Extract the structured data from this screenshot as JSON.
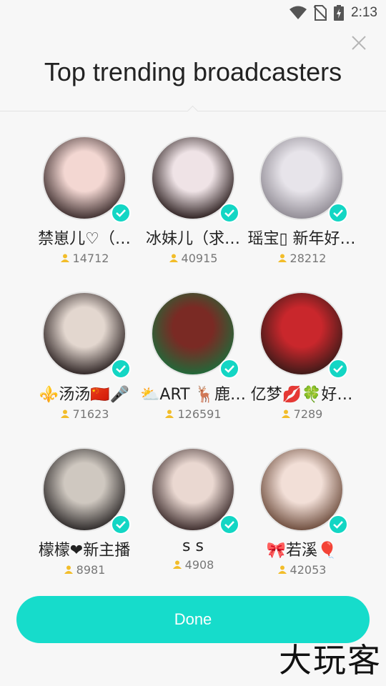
{
  "status": {
    "time": "2:13"
  },
  "header": {
    "title": "Top trending broadcasters"
  },
  "broadcasters": [
    {
      "name": "禁崽儿♡（…",
      "viewers": "14712",
      "tone": [
        "#f3d7d2",
        "#3a2b2b"
      ]
    },
    {
      "name": "冰妹儿（求…",
      "viewers": "40915",
      "tone": [
        "#efe3e6",
        "#2a1d1d"
      ]
    },
    {
      "name": "瑶宝▯ 新年好…",
      "viewers": "28212",
      "tone": [
        "#e7e4ea",
        "#8f8a93"
      ]
    },
    {
      "name": "⚜️汤汤🇨🇳🎤",
      "viewers": "71623",
      "tone": [
        "#e3d7cf",
        "#2a2020"
      ]
    },
    {
      "name": "⛅ART 🦌鹿…",
      "viewers": "126591",
      "tone": [
        "#7a2a24",
        "#1e6b3a"
      ]
    },
    {
      "name": "亿梦💋🍀好…",
      "viewers": "7289",
      "tone": [
        "#c9272c",
        "#3a1a18"
      ]
    },
    {
      "name": "檬檬❤新主播",
      "viewers": "8981",
      "tone": [
        "#cfc8c0",
        "#2a2626"
      ]
    },
    {
      "name": "s s",
      "viewers": "4908",
      "tone": [
        "#ead8d1",
        "#3a2a2a"
      ]
    },
    {
      "name": "🎀若溪🎈",
      "viewers": "42053",
      "tone": [
        "#f2dfd7",
        "#6b4a3a"
      ]
    }
  ],
  "done_button": {
    "label": "Done"
  },
  "watermark": "大玩客"
}
